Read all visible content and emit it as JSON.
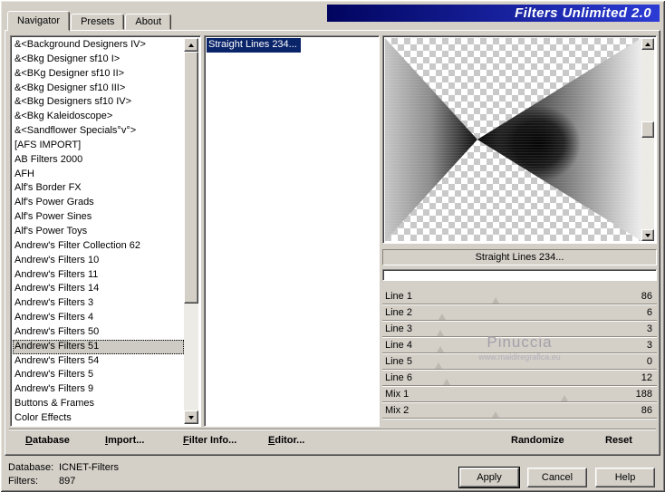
{
  "window": {
    "title": "Filters Unlimited 2.0"
  },
  "tabs": [
    {
      "label": "Navigator",
      "active": true
    },
    {
      "label": "Presets",
      "active": false
    },
    {
      "label": "About",
      "active": false
    }
  ],
  "navigator": {
    "items": [
      "&<Background Designers IV>",
      "&<Bkg Designer sf10 I>",
      "&<BKg Designer sf10 II>",
      "&<Bkg Designer sf10 III>",
      "&<Bkg Designers sf10 IV>",
      "&<Bkg Kaleidoscope>",
      "&<Sandflower Specials°v°>",
      "[AFS IMPORT]",
      "AB Filters 2000",
      "AFH",
      "Alf's Border FX",
      "Alf's Power Grads",
      "Alf's Power Sines",
      "Alf's Power Toys",
      "Andrew's Filter Collection 62",
      "Andrew's Filters 10",
      "Andrew's Filters 11",
      "Andrew's Filters 14",
      "Andrew's Filters 3",
      "Andrew's Filters 4",
      "Andrew's Filters 50",
      "Andrew's Filters 51",
      "Andrew's Filters 54",
      "Andrew's Filters 5",
      "Andrew's Filters 9",
      "Buttons & Frames",
      "Color Effects"
    ],
    "selected": "Andrew's Filters 51"
  },
  "filters": {
    "items": [
      "Straight Lines 234..."
    ],
    "selected": "Straight Lines 234..."
  },
  "controls": {
    "filter_name": "Straight Lines 234...",
    "param_max": 255,
    "params": [
      {
        "label": "Line 1",
        "value": 86
      },
      {
        "label": "Line 2",
        "value": 6
      },
      {
        "label": "Line 3",
        "value": 3
      },
      {
        "label": "Line 4",
        "value": 3
      },
      {
        "label": "Line 5",
        "value": 0
      },
      {
        "label": "Line 6",
        "value": 12
      },
      {
        "label": "Mix 1",
        "value": 188
      },
      {
        "label": "Mix 2",
        "value": 86
      }
    ],
    "randomize_label": "Randomize",
    "reset_label": "Reset"
  },
  "watermark": {
    "line1": "Pinuccia",
    "line2": "www.maidiregrafica.eu"
  },
  "toolbar": {
    "database": "Database",
    "import": "Import...",
    "filter_info": "Filter Info...",
    "editor": "Editor..."
  },
  "status": {
    "database_label": "Database:",
    "database_value": "ICNET-Filters",
    "filters_label": "Filters:",
    "filters_value": "897"
  },
  "actions": {
    "apply": "Apply",
    "cancel": "Cancel",
    "help": "Help"
  },
  "colors": {
    "dialog_bg": "#d4d0c8",
    "selection_blue": "#0a246a",
    "banner_gradient_start": "#01045e",
    "banner_gradient_end": "#2b3bd4"
  }
}
